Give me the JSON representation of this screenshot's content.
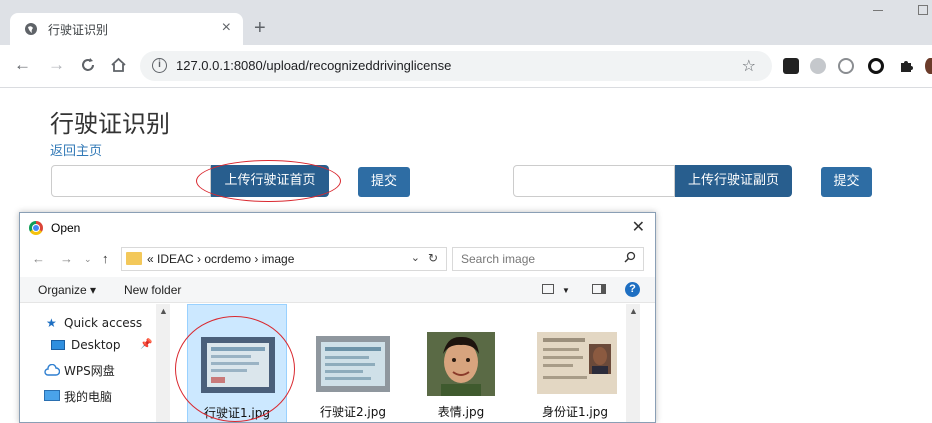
{
  "browser": {
    "tab_title": "行驶证识别",
    "tab_close": "×",
    "new_tab": "+",
    "url": "127.0.0.1:8080/upload/recognizeddrivinglicense"
  },
  "page": {
    "title": "行驶证识别",
    "home_link": "返回主页",
    "front_upload_label": "上传行驶证首页",
    "front_submit_label": "提交",
    "back_upload_label": "上传行驶证副页",
    "back_submit_label": "提交",
    "primary_color": "#337ab7",
    "highlight_color": "#d9282f"
  },
  "dialog": {
    "title": "Open",
    "breadcrumbs": "«  IDEAC  ›  ocrdemo  ›  image",
    "search_placeholder": "Search image",
    "organize_label": "Organize ▾",
    "new_folder_label": "New folder",
    "nav_items": [
      {
        "label": "Quick access",
        "icon": "star-icon"
      },
      {
        "label": "Desktop",
        "icon": "desktop-icon"
      },
      {
        "label": "WPS网盘",
        "icon": "cloud-icon"
      },
      {
        "label": "我的电脑",
        "icon": "computer-icon"
      }
    ],
    "files": [
      {
        "name": "行驶证1.jpg",
        "selected": true
      },
      {
        "name": "行驶证2.jpg",
        "selected": false
      },
      {
        "name": "表情.jpg",
        "selected": false
      },
      {
        "name": "身份证1.jpg",
        "selected": false
      }
    ]
  }
}
